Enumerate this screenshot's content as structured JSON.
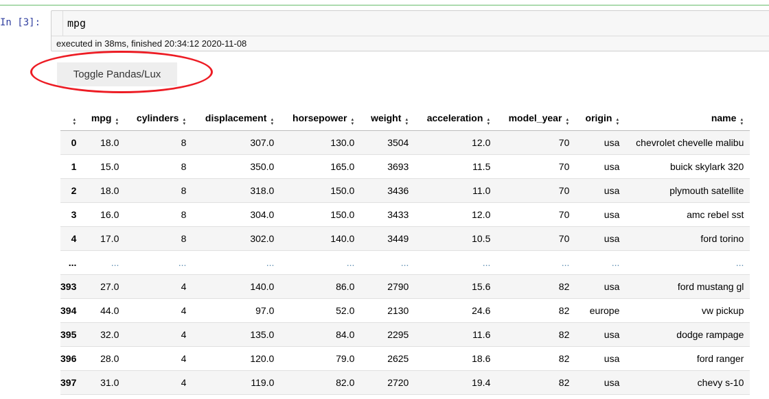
{
  "cell": {
    "prompt": "In [3]:",
    "code": "mpg",
    "exec_info": "executed in 38ms, finished 20:34:12 2020-11-08"
  },
  "toggle_button": {
    "label": "Toggle Pandas/Lux"
  },
  "highlight_color": "#ed1c24",
  "table": {
    "sort_icon": "sort-up-down-icon",
    "columns": [
      "",
      "mpg",
      "cylinders",
      "displacement",
      "horsepower",
      "weight",
      "acceleration",
      "model_year",
      "origin",
      "name"
    ],
    "rows": [
      [
        "0",
        "18.0",
        "8",
        "307.0",
        "130.0",
        "3504",
        "12.0",
        "70",
        "usa",
        "chevrolet chevelle malibu"
      ],
      [
        "1",
        "15.0",
        "8",
        "350.0",
        "165.0",
        "3693",
        "11.5",
        "70",
        "usa",
        "buick skylark 320"
      ],
      [
        "2",
        "18.0",
        "8",
        "318.0",
        "150.0",
        "3436",
        "11.0",
        "70",
        "usa",
        "plymouth satellite"
      ],
      [
        "3",
        "16.0",
        "8",
        "304.0",
        "150.0",
        "3433",
        "12.0",
        "70",
        "usa",
        "amc rebel sst"
      ],
      [
        "4",
        "17.0",
        "8",
        "302.0",
        "140.0",
        "3449",
        "10.5",
        "70",
        "usa",
        "ford torino"
      ],
      [
        "...",
        "...",
        "...",
        "...",
        "...",
        "...",
        "...",
        "...",
        "...",
        "..."
      ],
      [
        "393",
        "27.0",
        "4",
        "140.0",
        "86.0",
        "2790",
        "15.6",
        "82",
        "usa",
        "ford mustang gl"
      ],
      [
        "394",
        "44.0",
        "4",
        "97.0",
        "52.0",
        "2130",
        "24.6",
        "82",
        "europe",
        "vw pickup"
      ],
      [
        "395",
        "32.0",
        "4",
        "135.0",
        "84.0",
        "2295",
        "11.6",
        "82",
        "usa",
        "dodge rampage"
      ],
      [
        "396",
        "28.0",
        "4",
        "120.0",
        "79.0",
        "2625",
        "18.6",
        "82",
        "usa",
        "ford ranger"
      ],
      [
        "397",
        "31.0",
        "4",
        "119.0",
        "82.0",
        "2720",
        "19.4",
        "82",
        "usa",
        "chevy s-10"
      ]
    ]
  }
}
